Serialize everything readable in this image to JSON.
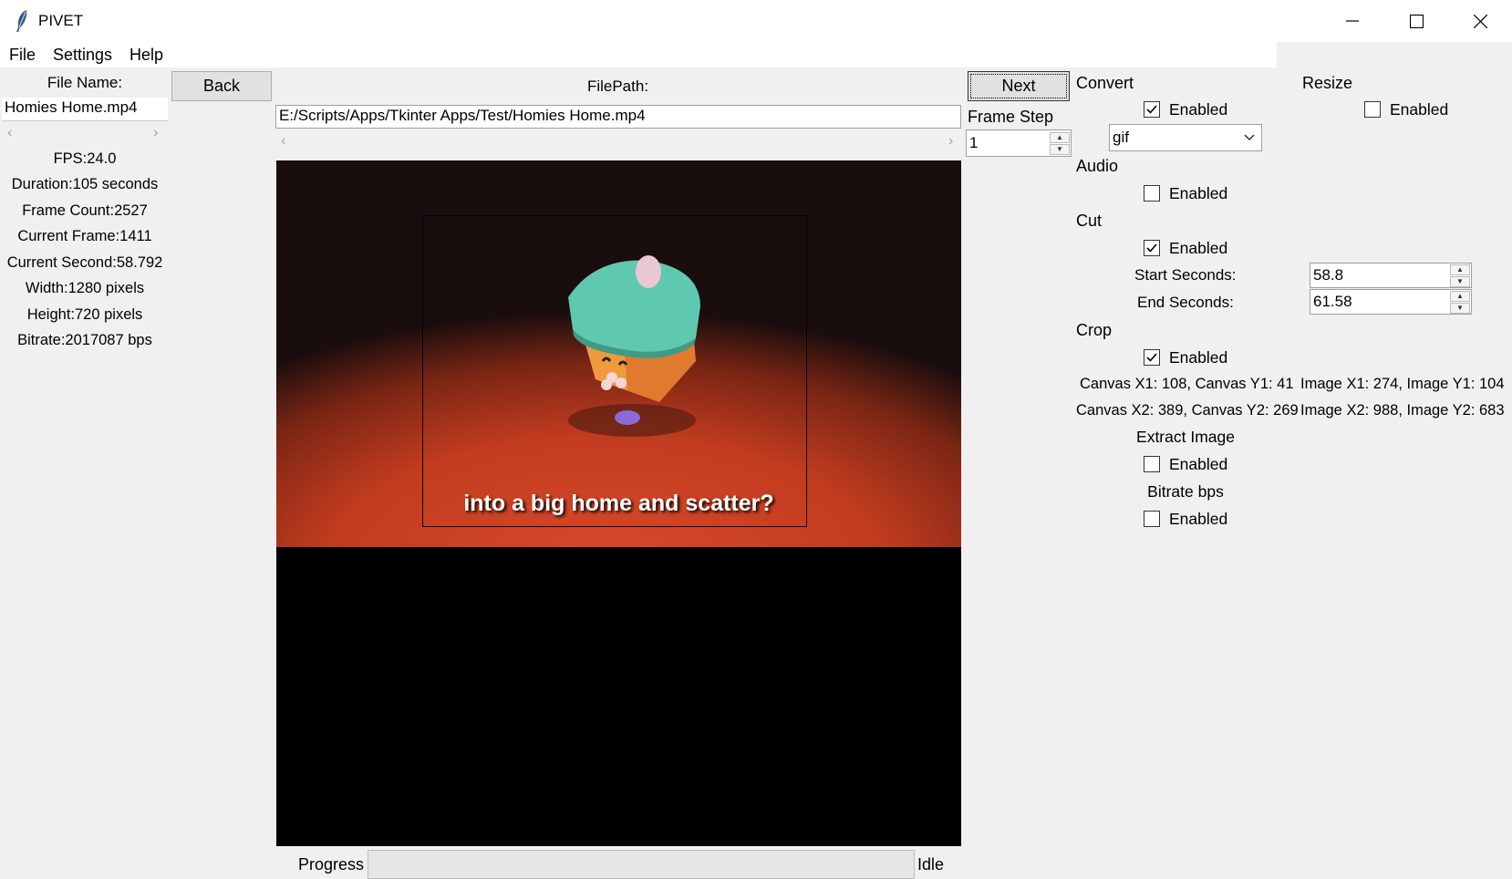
{
  "window": {
    "title": "PIVET",
    "icon": "feather-icon"
  },
  "menu": {
    "file": "File",
    "settings": "Settings",
    "help": "Help"
  },
  "left": {
    "file_name_label": "File Name:",
    "file_name_value": "Homies Home.mp4",
    "fps": "FPS:24.0",
    "duration": "Duration:105 seconds",
    "frame_count": "Frame Count:2527",
    "current_frame": "Current Frame:1411",
    "current_second": "Current Second:58.792",
    "width": "Width:1280 pixels",
    "height": "Height:720 pixels",
    "bitrate": "Bitrate:2017087 bps"
  },
  "nav": {
    "back": "Back",
    "next": "Next",
    "filepath_label": "FilePath:",
    "filepath_value": "E:/Scripts/Apps/Tkinter Apps/Test/Homies Home.mp4",
    "frame_step_label": "Frame Step",
    "frame_step_value": "1"
  },
  "video": {
    "subtitle": "into a big home and scatter?"
  },
  "right": {
    "convert": {
      "label": "Convert",
      "enabled": "Enabled",
      "checked": true,
      "format": "gif"
    },
    "resize": {
      "label": "Resize",
      "enabled": "Enabled",
      "checked": false
    },
    "audio": {
      "label": "Audio",
      "enabled": "Enabled",
      "checked": false
    },
    "cut": {
      "label": "Cut",
      "enabled": "Enabled",
      "checked": true,
      "start_label": "Start Seconds:",
      "start_value": "58.8",
      "end_label": "End Seconds:",
      "end_value": "61.58"
    },
    "crop": {
      "label": "Crop",
      "enabled": "Enabled",
      "checked": true,
      "line1_canvas": "Canvas X1: 108, Canvas Y1: 41",
      "line1_image": "Image X1: 274, Image Y1: 104",
      "line2_canvas": "Canvas X2: 389, Canvas Y2: 269",
      "line2_image": "Image X2: 988, Image Y2: 683"
    },
    "extract": {
      "label": "Extract Image",
      "enabled": "Enabled",
      "checked": false
    },
    "bitrate": {
      "label": "Bitrate bps",
      "enabled": "Enabled",
      "checked": false
    }
  },
  "status": {
    "progress_label": "Progress",
    "progress_value": 0,
    "state": "Idle"
  }
}
